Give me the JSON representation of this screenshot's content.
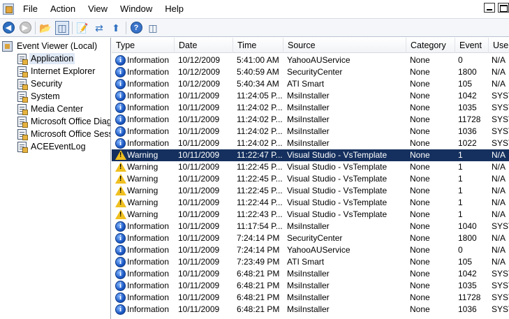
{
  "menu": {
    "items": [
      "File",
      "Action",
      "View",
      "Window",
      "Help"
    ]
  },
  "tree": {
    "root": "Event Viewer (Local)",
    "logs": [
      "Application",
      "Internet Explorer",
      "Security",
      "System",
      "Media Center",
      "Microsoft Office Diag",
      "Microsoft Office Sess",
      "ACEEventLog"
    ],
    "selected_index": 0
  },
  "columns": {
    "type": "Type",
    "date": "Date",
    "time": "Time",
    "source": "Source",
    "category": "Category",
    "event": "Event",
    "user": "User"
  },
  "events": [
    {
      "type": "Information",
      "date": "10/12/2009",
      "time": "5:41:00 AM",
      "source": "YahooAUService",
      "category": "None",
      "event": "0",
      "user": "N/A"
    },
    {
      "type": "Information",
      "date": "10/12/2009",
      "time": "5:40:59 AM",
      "source": "SecurityCenter",
      "category": "None",
      "event": "1800",
      "user": "N/A"
    },
    {
      "type": "Information",
      "date": "10/12/2009",
      "time": "5:40:34 AM",
      "source": "ATI Smart",
      "category": "None",
      "event": "105",
      "user": "N/A"
    },
    {
      "type": "Information",
      "date": "10/11/2009",
      "time": "11:24:05 P...",
      "source": "MsiInstaller",
      "category": "None",
      "event": "1042",
      "user": "SYST"
    },
    {
      "type": "Information",
      "date": "10/11/2009",
      "time": "11:24:02 P...",
      "source": "MsiInstaller",
      "category": "None",
      "event": "1035",
      "user": "SYST"
    },
    {
      "type": "Information",
      "date": "10/11/2009",
      "time": "11:24:02 P...",
      "source": "MsiInstaller",
      "category": "None",
      "event": "11728",
      "user": "SYST"
    },
    {
      "type": "Information",
      "date": "10/11/2009",
      "time": "11:24:02 P...",
      "source": "MsiInstaller",
      "category": "None",
      "event": "1036",
      "user": "SYST"
    },
    {
      "type": "Information",
      "date": "10/11/2009",
      "time": "11:24:02 P...",
      "source": "MsiInstaller",
      "category": "None",
      "event": "1022",
      "user": "SYST"
    },
    {
      "type": "Warning",
      "date": "10/11/2009",
      "time": "11:22:47 P...",
      "source": "Visual Studio - VsTemplate",
      "category": "None",
      "event": "1",
      "user": "N/A",
      "selected": true
    },
    {
      "type": "Warning",
      "date": "10/11/2009",
      "time": "11:22:45 P...",
      "source": "Visual Studio - VsTemplate",
      "category": "None",
      "event": "1",
      "user": "N/A"
    },
    {
      "type": "Warning",
      "date": "10/11/2009",
      "time": "11:22:45 P...",
      "source": "Visual Studio - VsTemplate",
      "category": "None",
      "event": "1",
      "user": "N/A"
    },
    {
      "type": "Warning",
      "date": "10/11/2009",
      "time": "11:22:45 P...",
      "source": "Visual Studio - VsTemplate",
      "category": "None",
      "event": "1",
      "user": "N/A"
    },
    {
      "type": "Warning",
      "date": "10/11/2009",
      "time": "11:22:44 P...",
      "source": "Visual Studio - VsTemplate",
      "category": "None",
      "event": "1",
      "user": "N/A"
    },
    {
      "type": "Warning",
      "date": "10/11/2009",
      "time": "11:22:43 P...",
      "source": "Visual Studio - VsTemplate",
      "category": "None",
      "event": "1",
      "user": "N/A"
    },
    {
      "type": "Information",
      "date": "10/11/2009",
      "time": "11:17:54 P...",
      "source": "MsiInstaller",
      "category": "None",
      "event": "1040",
      "user": "SYST"
    },
    {
      "type": "Information",
      "date": "10/11/2009",
      "time": "7:24:14 PM",
      "source": "SecurityCenter",
      "category": "None",
      "event": "1800",
      "user": "N/A"
    },
    {
      "type": "Information",
      "date": "10/11/2009",
      "time": "7:24:14 PM",
      "source": "YahooAUService",
      "category": "None",
      "event": "0",
      "user": "N/A"
    },
    {
      "type": "Information",
      "date": "10/11/2009",
      "time": "7:23:49 PM",
      "source": "ATI Smart",
      "category": "None",
      "event": "105",
      "user": "N/A"
    },
    {
      "type": "Information",
      "date": "10/11/2009",
      "time": "6:48:21 PM",
      "source": "MsiInstaller",
      "category": "None",
      "event": "1042",
      "user": "SYST"
    },
    {
      "type": "Information",
      "date": "10/11/2009",
      "time": "6:48:21 PM",
      "source": "MsiInstaller",
      "category": "None",
      "event": "1035",
      "user": "SYST"
    },
    {
      "type": "Information",
      "date": "10/11/2009",
      "time": "6:48:21 PM",
      "source": "MsiInstaller",
      "category": "None",
      "event": "11728",
      "user": "SYST"
    },
    {
      "type": "Information",
      "date": "10/11/2009",
      "time": "6:48:21 PM",
      "source": "MsiInstaller",
      "category": "None",
      "event": "1036",
      "user": "SYST"
    }
  ],
  "colors": {
    "selection": "#15305e",
    "tree_selection": "#dfe8f5",
    "info_blue": "#1d59c4",
    "warning_yellow": "#f0c020"
  }
}
